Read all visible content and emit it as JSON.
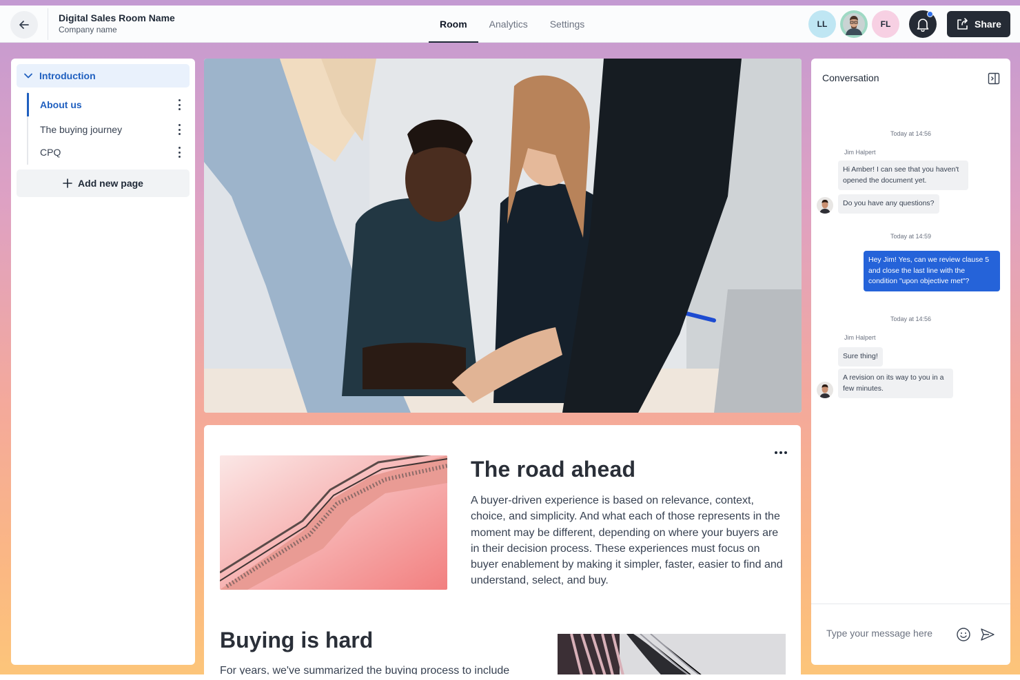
{
  "header": {
    "room_name": "Digital Sales Room Name",
    "company_name": "Company name",
    "tabs": [
      {
        "label": "Room",
        "active": true
      },
      {
        "label": "Analytics",
        "active": false
      },
      {
        "label": "Settings",
        "active": false
      }
    ],
    "avatars": [
      {
        "initials": "LL",
        "color": "#bfe6f3"
      },
      {
        "initials": "",
        "color": "#9fd9c4"
      },
      {
        "initials": "FL",
        "color": "#f7d0e3"
      }
    ],
    "share_label": "Share",
    "notification_dot_color": "#2f6fe8"
  },
  "sidebar": {
    "section_title": "Introduction",
    "pages": [
      {
        "label": "About us",
        "active": true
      },
      {
        "label": "The buying journey",
        "active": false
      },
      {
        "label": "CPQ",
        "active": false
      }
    ],
    "add_page_label": "Add new page"
  },
  "content": {
    "section1_title": "The road ahead",
    "section1_body": "A buyer-driven experience is based on relevance, context, choice, and simplicity. And what each of those represents in the moment may be different, depending on where your buyers are in their decision process. These experiences must focus on buyer enablement by making it simpler, faster, easier to find and understand, select, and buy.",
    "section2_title": "Buying is hard",
    "section2_body": "For years, we've summarized the buying process to include"
  },
  "conversation": {
    "title": "Conversation",
    "groups": [
      {
        "time": "Today at 14:56",
        "sender": "Jim Halpert",
        "messages": [
          "Hi Amber! I can see that you haven't opened the document yet.",
          "Do you have any questions?"
        ]
      },
      {
        "time": "Today at 14:59",
        "sender": "",
        "messages": [
          "Hey Jim! Yes, can we review clause 5 and close the last line with the condition \"upon objective met\"?"
        ]
      },
      {
        "time": "Today at 14:56",
        "sender": "Jim Halpert",
        "messages": [
          "Sure thing!",
          "A revision on its way to you in a few minutes."
        ]
      }
    ],
    "composer_placeholder": "Type your message here"
  },
  "colors": {
    "accent_blue": "#1f5fbf",
    "my_bubble": "#2563d9",
    "dark_button": "#252b35"
  }
}
